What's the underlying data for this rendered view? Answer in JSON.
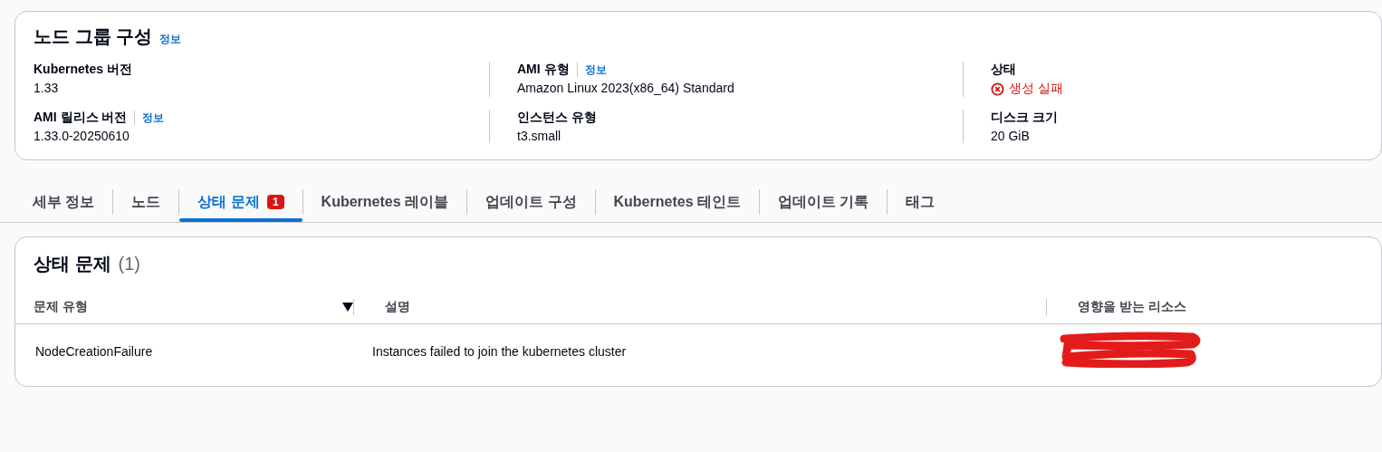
{
  "config": {
    "title": "노드 그룹 구성",
    "info": "정보",
    "fields": [
      {
        "label": "Kubernetes 버전",
        "value": "1.33",
        "kind": "plain"
      },
      {
        "label": "AMI 유형",
        "info": "정보",
        "value": "Amazon Linux 2023(x86_64) Standard",
        "kind": "plain"
      },
      {
        "label": "상태",
        "value": "생성 실패",
        "kind": "error"
      },
      {
        "label": "AMI 릴리스 버전",
        "info": "정보",
        "value": "1.33.0-20250610",
        "kind": "plain"
      },
      {
        "label": "인스턴스 유형",
        "value": "t3.small",
        "kind": "plain"
      },
      {
        "label": "디스크 크기",
        "value": "20 GiB",
        "kind": "plain"
      }
    ]
  },
  "tabs": [
    {
      "label": "세부 정보",
      "selected": false
    },
    {
      "label": "노드",
      "selected": false
    },
    {
      "label": "상태 문제",
      "badge": "1",
      "selected": true
    },
    {
      "label": "Kubernetes 레이블",
      "selected": false
    },
    {
      "label": "업데이트 구성",
      "selected": false
    },
    {
      "label": "Kubernetes 테인트",
      "selected": false
    },
    {
      "label": "업데이트 기록",
      "selected": false
    },
    {
      "label": "태그",
      "selected": false
    }
  ],
  "issues": {
    "title": "상태 문제",
    "count": "(1)",
    "columns": [
      {
        "label": "문제 유형",
        "sorted": true
      },
      {
        "label": "설명",
        "sorted": false
      },
      {
        "label": "영향을 받는 리소스",
        "sorted": false
      }
    ],
    "rows": [
      {
        "problem_type": "NodeCreationFailure",
        "description": "Instances failed to join the kubernetes cluster",
        "resource_redacted": true
      }
    ]
  }
}
